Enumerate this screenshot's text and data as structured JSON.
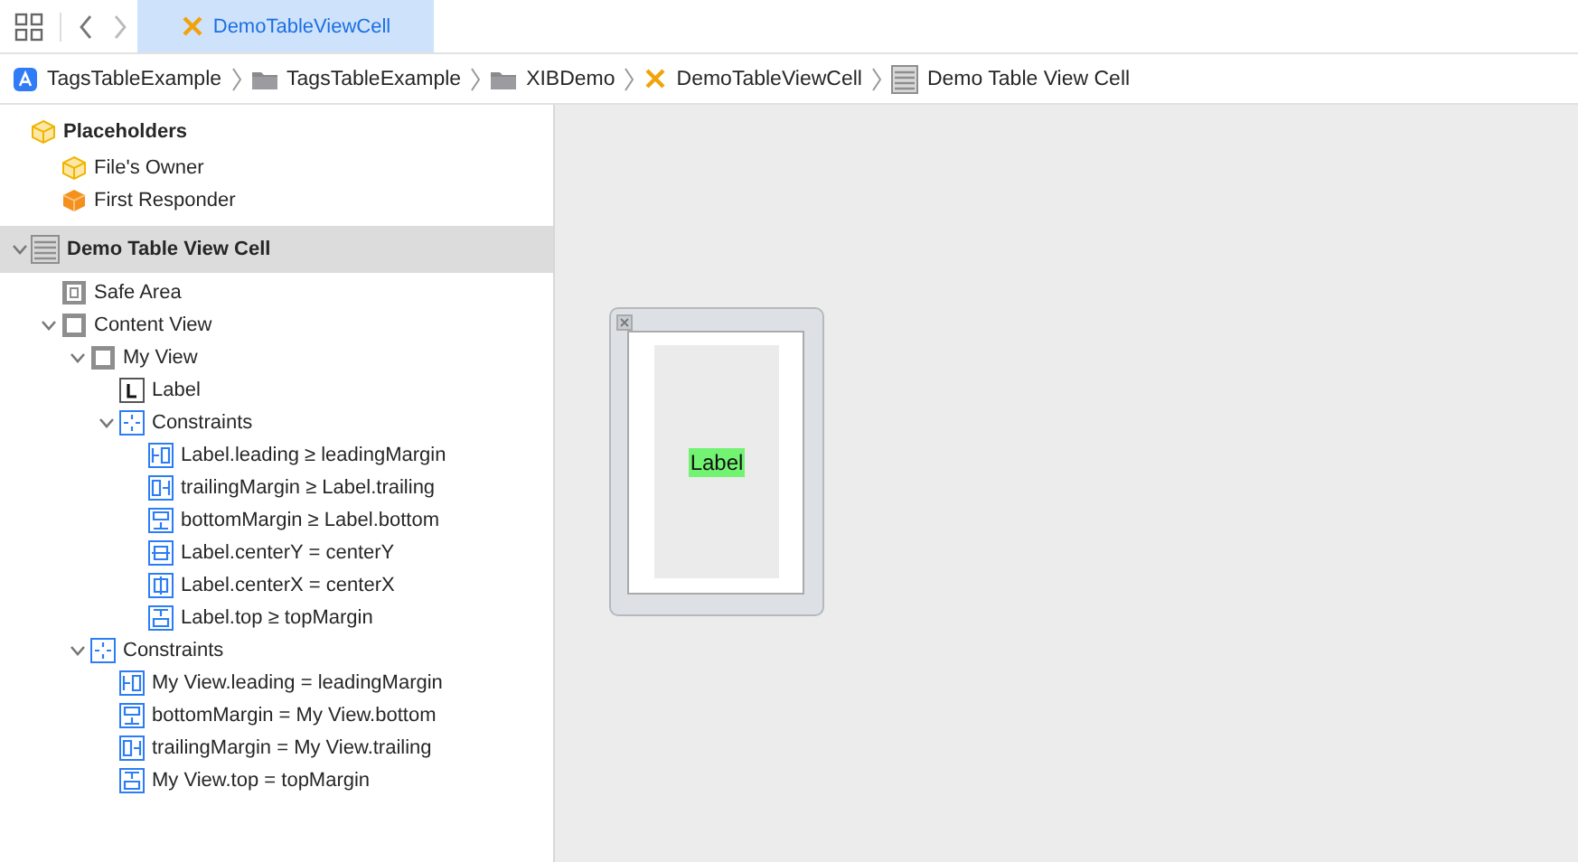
{
  "tab_bar": {
    "tabs": [
      {
        "label": "DemoTableViewCell",
        "kind": "xib",
        "selected": true
      }
    ]
  },
  "breadcrumb": [
    {
      "kind": "app",
      "label": "TagsTableExample"
    },
    {
      "kind": "folder",
      "label": "TagsTableExample"
    },
    {
      "kind": "folder",
      "label": "XIBDemo"
    },
    {
      "kind": "xib",
      "label": "DemoTableViewCell"
    },
    {
      "kind": "cell",
      "label": "Demo Table View Cell"
    }
  ],
  "outline": [
    {
      "kind": "placeholders",
      "label": "Placeholders",
      "selected": false,
      "children": [
        {
          "kind": "owner",
          "label": "File's Owner",
          "selected": false
        },
        {
          "kind": "responder",
          "label": "First Responder",
          "selected": false
        }
      ]
    },
    {
      "kind": "cell",
      "label": "Demo Table View Cell",
      "selected": true,
      "expanded": true,
      "children": [
        {
          "kind": "safe",
          "label": "Safe Area",
          "selected": false
        },
        {
          "kind": "view",
          "label": "Content View",
          "selected": false,
          "expanded": true,
          "children": [
            {
              "kind": "view",
              "label": "My View",
              "selected": false,
              "expanded": true,
              "children": [
                {
                  "kind": "label",
                  "label": "Label",
                  "selected": false
                },
                {
                  "kind": "constraints",
                  "label": "Constraints",
                  "selected": false,
                  "expanded": true,
                  "children": [
                    {
                      "kind": "leading",
                      "label": "Label.leading ≥ leadingMargin",
                      "selected": false
                    },
                    {
                      "kind": "trailing",
                      "label": "trailingMargin ≥ Label.trailing",
                      "selected": false
                    },
                    {
                      "kind": "bottom",
                      "label": "bottomMargin ≥ Label.bottom",
                      "selected": false
                    },
                    {
                      "kind": "centery",
                      "label": "Label.centerY = centerY",
                      "selected": false
                    },
                    {
                      "kind": "centerx",
                      "label": "Label.centerX = centerX",
                      "selected": false
                    },
                    {
                      "kind": "top",
                      "label": "Label.top ≥ topMargin",
                      "selected": false
                    }
                  ]
                }
              ]
            },
            {
              "kind": "constraints",
              "label": "Constraints",
              "selected": false,
              "expanded": true,
              "children": [
                {
                  "kind": "leading",
                  "label": "My View.leading = leadingMargin",
                  "selected": false
                },
                {
                  "kind": "bottom",
                  "label": "bottomMargin = My View.bottom",
                  "selected": false
                },
                {
                  "kind": "trailing",
                  "label": "trailingMargin = My View.trailing",
                  "selected": false
                },
                {
                  "kind": "top",
                  "label": "My View.top = topMargin",
                  "selected": false
                }
              ]
            }
          ]
        }
      ]
    }
  ],
  "canvas": {
    "label": "Label"
  }
}
